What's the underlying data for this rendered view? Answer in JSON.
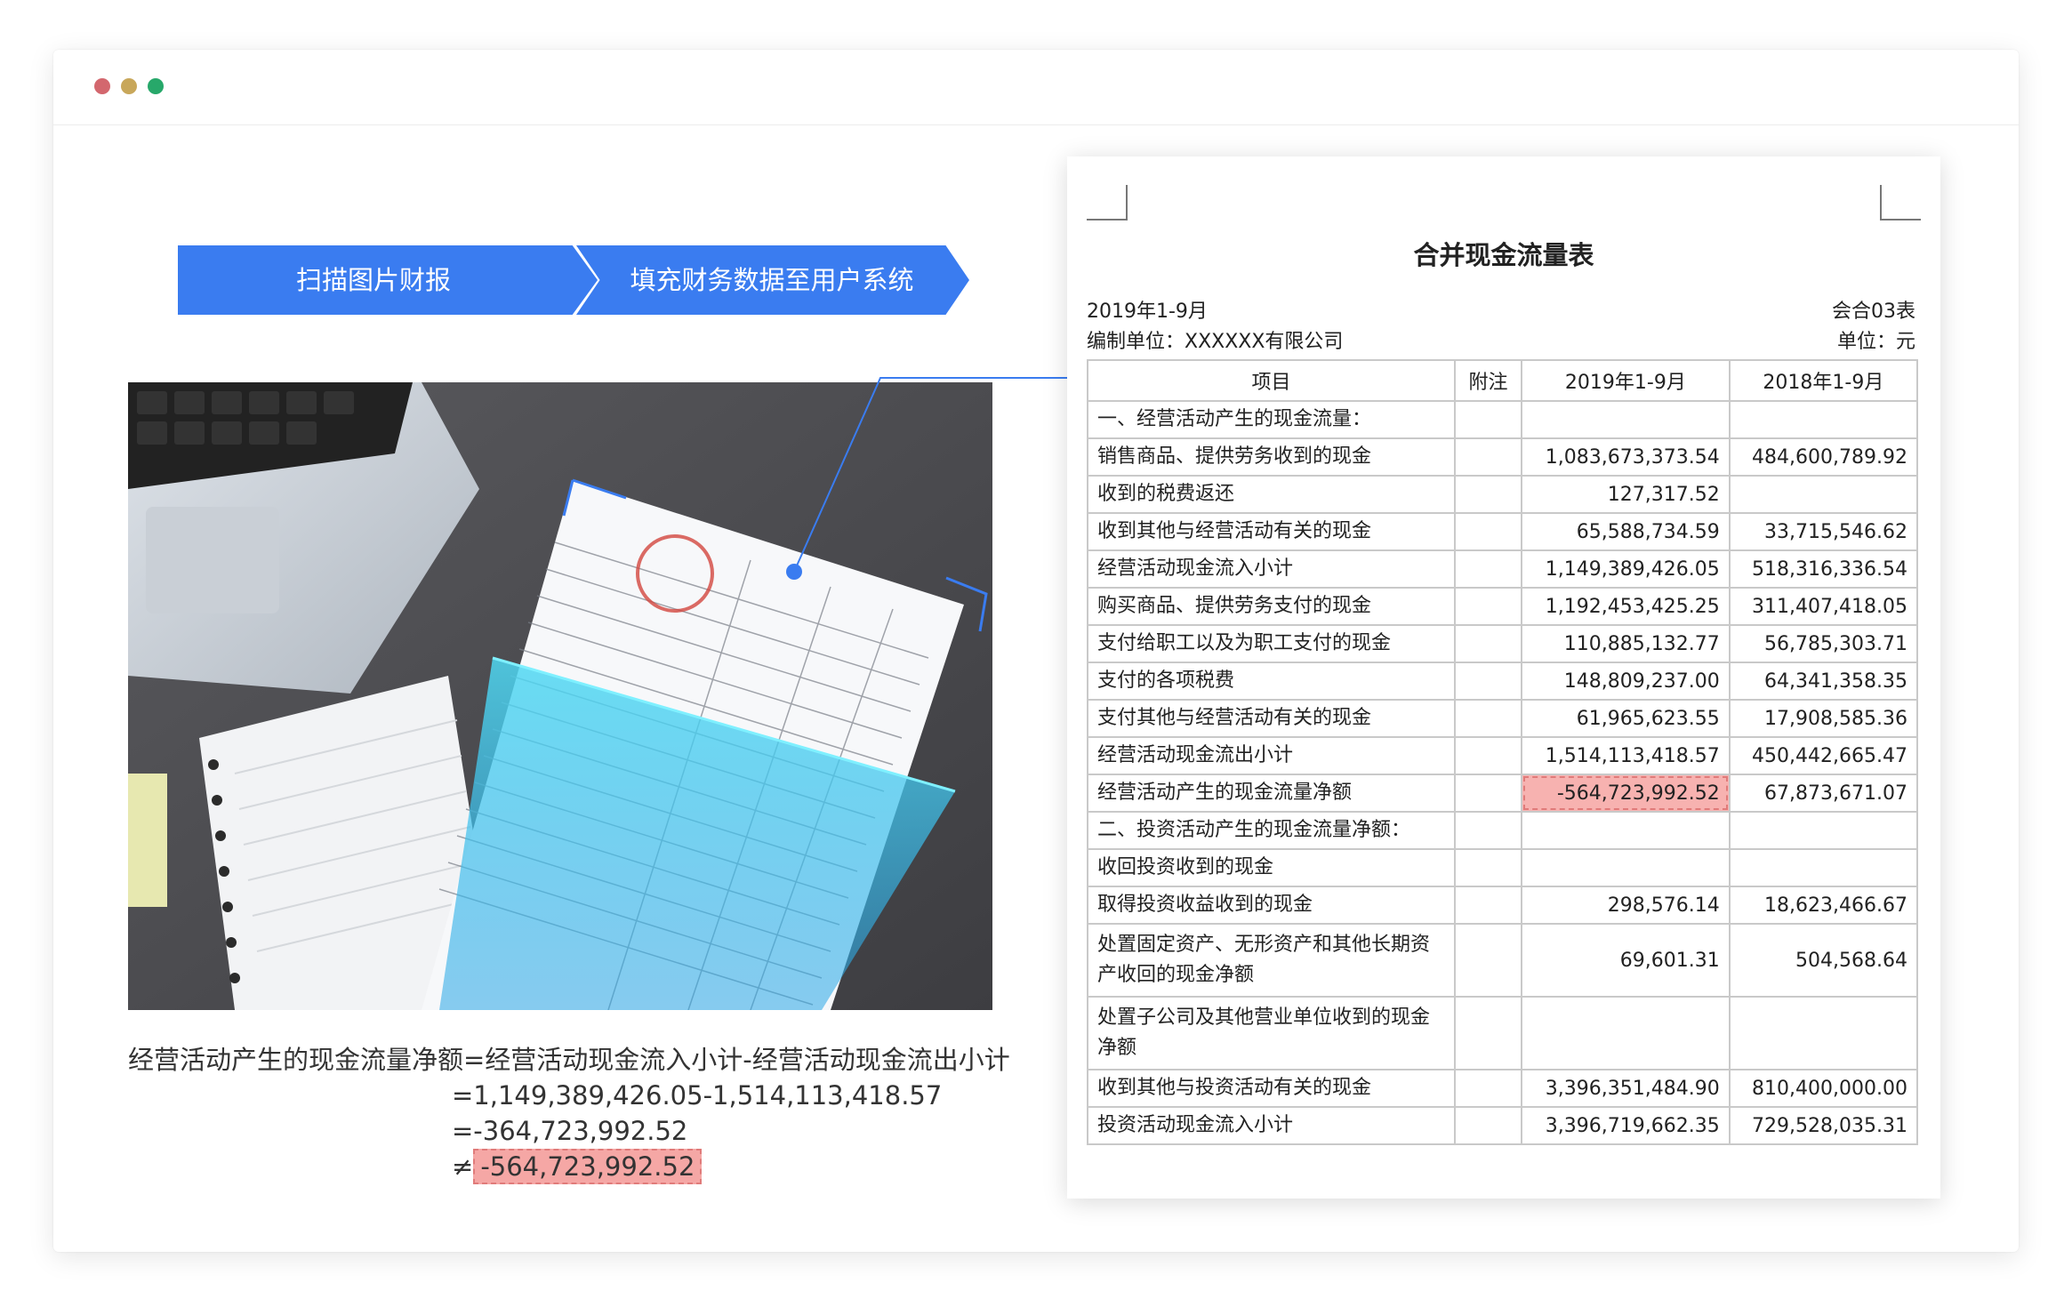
{
  "window": {
    "controls": [
      "close",
      "minimize",
      "maximize"
    ]
  },
  "steps": {
    "step1": "扫描图片财报",
    "step2": "填充财务数据至用户系统"
  },
  "formula": {
    "line1": "经营活动产生的现金流量净额=经营活动现金流入小计-经营活动现金流出小计",
    "line2": "=1,149,389,426.05-1,514,113,418.57",
    "line3": "=-364,723,992.52",
    "neq": "≠",
    "highlight": "-564,723,992.52"
  },
  "document": {
    "title": "合并现金流量表",
    "period": "2019年1-9月",
    "company": "编制单位：XXXXXX有限公司",
    "form_no": "会合03表",
    "unit": "单位：元",
    "headers": [
      "项目",
      "附注",
      "2019年1-9月",
      "2018年1-9月"
    ],
    "rows": [
      {
        "item": "一、经营活动产生的现金流量：",
        "note": "",
        "a": "",
        "b": ""
      },
      {
        "item": "销售商品、提供劳务收到的现金",
        "note": "",
        "a": "1,083,673,373.54",
        "b": "484,600,789.92"
      },
      {
        "item": "收到的税费返还",
        "note": "",
        "a": "127,317.52",
        "b": ""
      },
      {
        "item": "收到其他与经营活动有关的现金",
        "note": "",
        "a": "65,588,734.59",
        "b": "33,715,546.62"
      },
      {
        "item": "经营活动现金流入小计",
        "note": "",
        "a": "1,149,389,426.05",
        "b": "518,316,336.54"
      },
      {
        "item": "购买商品、提供劳务支付的现金",
        "note": "",
        "a": "1,192,453,425.25",
        "b": "311,407,418.05"
      },
      {
        "item": "支付给职工以及为职工支付的现金",
        "note": "",
        "a": "110,885,132.77",
        "b": "56,785,303.71"
      },
      {
        "item": "支付的各项税费",
        "note": "",
        "a": "148,809,237.00",
        "b": "64,341,358.35"
      },
      {
        "item": "支付其他与经营活动有关的现金",
        "note": "",
        "a": "61,965,623.55",
        "b": "17,908,585.36"
      },
      {
        "item": "经营活动现金流出小计",
        "note": "",
        "a": "1,514,113,418.57",
        "b": "450,442,665.47"
      },
      {
        "item": "经营活动产生的现金流量净额",
        "note": "",
        "a": "-564,723,992.52",
        "b": "67,873,671.07",
        "highlight_a": true
      },
      {
        "item": "二、投资活动产生的现金流量净额：",
        "note": "",
        "a": "",
        "b": ""
      },
      {
        "item": "收回投资收到的现金",
        "note": "",
        "a": "",
        "b": ""
      },
      {
        "item": "取得投资收益收到的现金",
        "note": "",
        "a": "298,576.14",
        "b": "18,623,466.67"
      },
      {
        "item": "处置固定资产、无形资产和其他长期资产收回的现金净额",
        "note": "",
        "a": "69,601.31",
        "b": "504,568.64",
        "tall": true
      },
      {
        "item": "处置子公司及其他营业单位收到的现金净额",
        "note": "",
        "a": "",
        "b": "",
        "tall": true
      },
      {
        "item": "收到其他与投资活动有关的现金",
        "note": "",
        "a": "3,396,351,484.90",
        "b": "810,400,000.00"
      },
      {
        "item": "投资活动现金流入小计",
        "note": "",
        "a": "3,396,719,662.35",
        "b": "729,528,035.31"
      }
    ]
  },
  "colors": {
    "accent": "#3a7cf0",
    "error_fill": "#f7b2b0",
    "scan_cyan": "#4fd8f2"
  }
}
